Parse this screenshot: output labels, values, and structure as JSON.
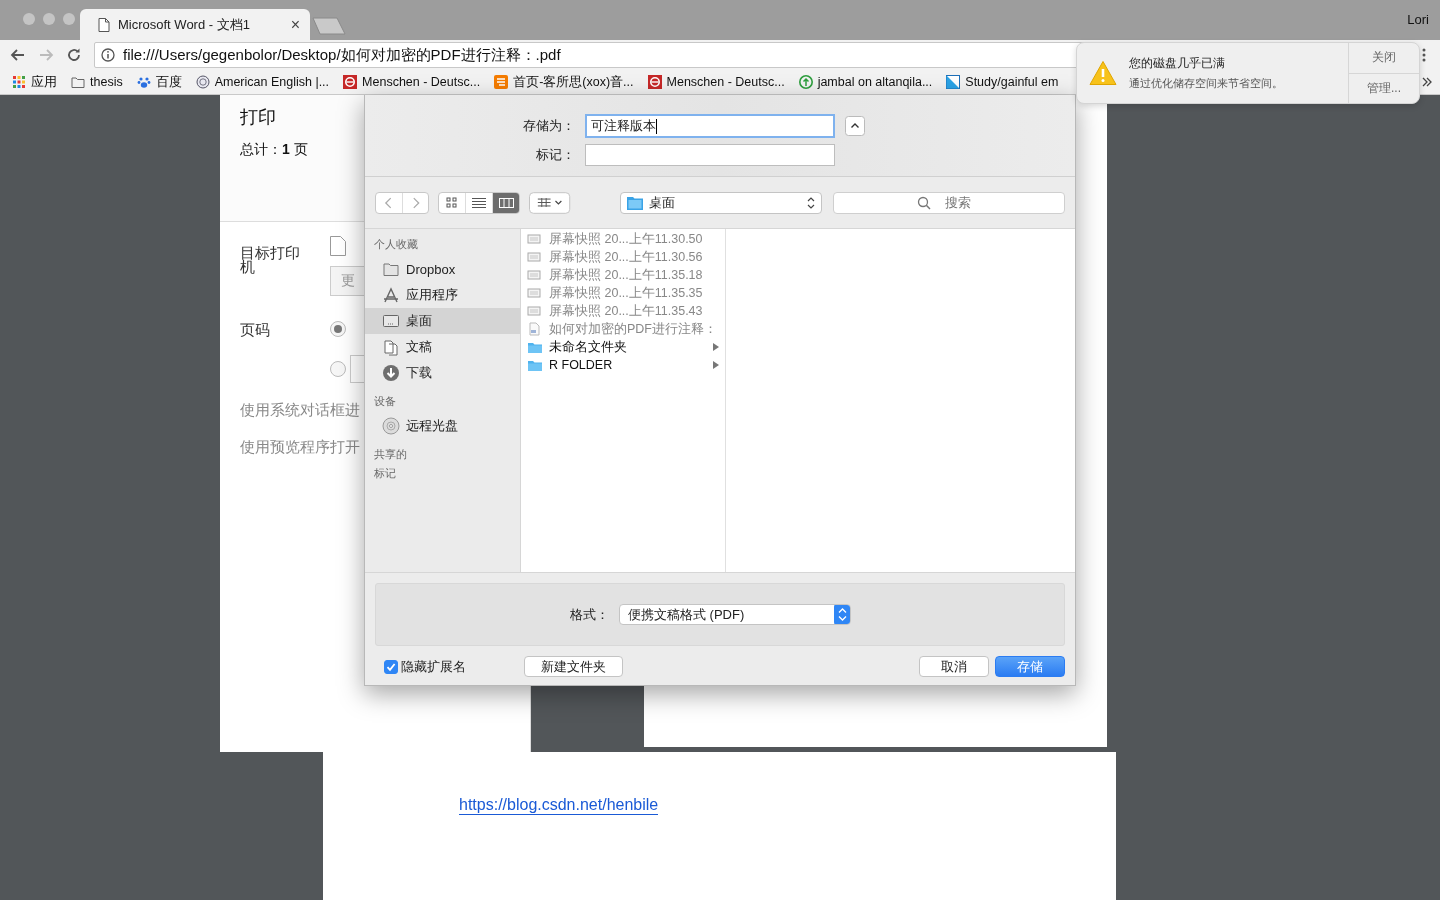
{
  "browser": {
    "tab": {
      "title": "Microsoft Word - 文档1",
      "close": "×"
    },
    "user": "Lori",
    "url": "file:///Users/gegenbolor/Desktop/如何对加密的PDF进行注释：.pdf",
    "bookmarks": [
      {
        "kind": "apps",
        "label": "应用"
      },
      {
        "kind": "folder",
        "label": "thesis"
      },
      {
        "kind": "paw",
        "label": "百度"
      },
      {
        "kind": "seal",
        "label": "American English |..."
      },
      {
        "kind": "e",
        "label": "Menschen - Deutsc..."
      },
      {
        "kind": "tao",
        "label": "首页-客所思(xox)音..."
      },
      {
        "kind": "e",
        "label": "Menschen - Deutsc..."
      },
      {
        "kind": "tree",
        "label": "jambal on altanqila..."
      },
      {
        "kind": "corner",
        "label": "Study/gainful em"
      }
    ]
  },
  "notification": {
    "title": "您的磁盘几乎已满",
    "message": "通过优化储存空间来节省空间。",
    "buttons": [
      "关闭",
      "管理..."
    ]
  },
  "document": {
    "link": "https://blog.csdn.net/henbile"
  },
  "print_panel": {
    "title": "打印",
    "total": "总计：**1** 页",
    "destination_label": "目标打印机",
    "change_button": "更",
    "pages_label": "页码",
    "page_options": [
      {
        "selected": true
      },
      {
        "selected": false
      }
    ],
    "links": [
      "使用系统对话框进",
      "使用预览程序打开"
    ]
  },
  "save_dialog": {
    "save_as_label": "存储为：",
    "save_as_value": "可注释版本",
    "tags_label": "标记：",
    "view_modes": [
      {
        "kind": "icons",
        "selected": false
      },
      {
        "kind": "list",
        "selected": false
      },
      {
        "kind": "columns",
        "selected": true
      }
    ],
    "location": "桌面",
    "search_placeholder": "搜索",
    "sidebar": [
      {
        "heading": "个人收藏",
        "items": [
          {
            "kind": "folder",
            "label": "Dropbox",
            "selected": false
          },
          {
            "kind": "apps",
            "label": "应用程序",
            "selected": false
          },
          {
            "kind": "desktop",
            "label": "桌面",
            "selected": true
          },
          {
            "kind": "documents",
            "label": "文稿",
            "selected": false
          },
          {
            "kind": "downloads",
            "label": "下载",
            "selected": false
          }
        ]
      },
      {
        "heading": "设备",
        "items": [
          {
            "kind": "disc",
            "label": "远程光盘",
            "selected": false
          }
        ]
      },
      {
        "heading": "共享的"
      },
      {
        "heading": "标记"
      }
    ],
    "files": [
      {
        "kind": "screenshot",
        "name": "屏幕快照 20...上午11.30.50",
        "disabled": true
      },
      {
        "kind": "screenshot",
        "name": "屏幕快照 20...上午11.30.56",
        "disabled": true
      },
      {
        "kind": "screenshot",
        "name": "屏幕快照 20...上午11.35.18",
        "disabled": true
      },
      {
        "kind": "screenshot",
        "name": "屏幕快照 20...上午11.35.35",
        "disabled": true
      },
      {
        "kind": "screenshot",
        "name": "屏幕快照 20...上午11.35.43",
        "disabled": true
      },
      {
        "kind": "pdf",
        "name": "如何对加密的PDF进行注释：",
        "disabled": true
      },
      {
        "kind": "folder",
        "name": "未命名文件夹",
        "disabled": false
      },
      {
        "kind": "folder",
        "name": "R FOLDER",
        "disabled": false
      }
    ],
    "format_label": "格式：",
    "format_value": "便携文稿格式 (PDF)",
    "hide_extension": {
      "label": "隐藏扩展名",
      "checked": true
    },
    "new_folder": "新建文件夹",
    "cancel": "取消",
    "save": "存储"
  }
}
